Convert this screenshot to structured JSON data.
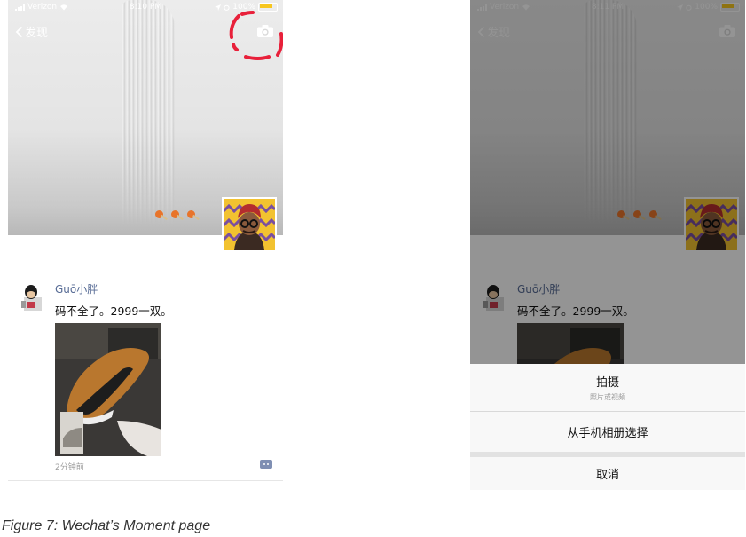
{
  "screens": {
    "left": {
      "status": {
        "carrier": "Verizon",
        "time": "8:10 PM",
        "battery": "100%"
      },
      "nav": {
        "back_label": "发现"
      },
      "post": {
        "author": "Guō小胖",
        "text": "码不全了。2999一双。",
        "time": "2分钟前"
      },
      "highlight_color": "#e8203a"
    },
    "right": {
      "status": {
        "carrier": "Verizon",
        "time": "8:11 PM",
        "battery": "100%"
      },
      "nav": {
        "back_label": "发现"
      },
      "post": {
        "author": "Guō小胖",
        "text": "码不全了。2999一双。"
      },
      "action_sheet": {
        "take_photo": {
          "label": "拍摄",
          "sublabel": "照片或视频"
        },
        "choose_album": {
          "label": "从手机相册选择"
        },
        "cancel": {
          "label": "取消"
        }
      }
    }
  },
  "caption": "Figure 7: Wechat’s Moment page",
  "colors": {
    "link_blue": "#576b95",
    "battery_yellow": "#f7c61e",
    "lollipop_orange": "#e8742a"
  },
  "icons": [
    "back-chevron-icon",
    "camera-icon",
    "wifi-icon",
    "alarm-icon",
    "location-icon",
    "comment-icon"
  ]
}
